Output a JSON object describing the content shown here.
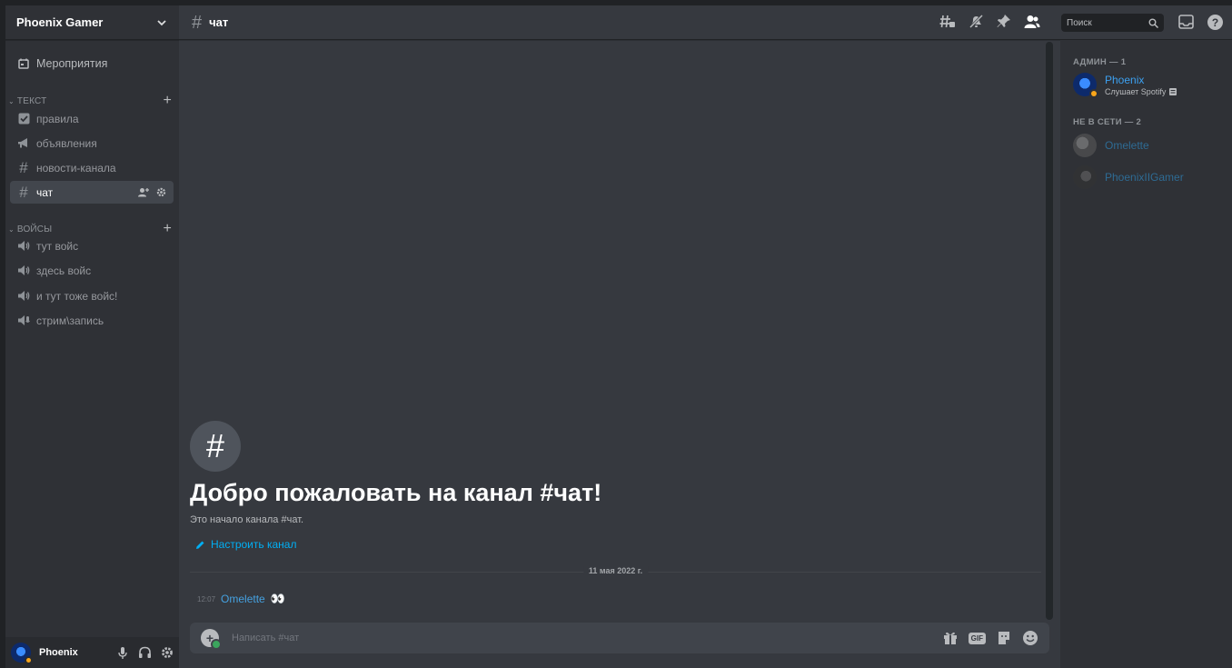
{
  "server": {
    "name": "Phoenix Gamer"
  },
  "sidebar": {
    "events_label": "Мероприятия",
    "categories": [
      {
        "name": "ТЕКСТ"
      },
      {
        "name": "ВОЙСЫ"
      }
    ],
    "text_channels": [
      {
        "label": "правила",
        "icon": "rules-icon"
      },
      {
        "label": "объявления",
        "icon": "megaphone-icon"
      },
      {
        "label": "новости-канала",
        "icon": "hash-icon"
      },
      {
        "label": "чат",
        "icon": "hash-icon",
        "active": true
      }
    ],
    "voice_channels": [
      {
        "label": "тут войс",
        "icon": "speaker-icon"
      },
      {
        "label": "здесь войс",
        "icon": "speaker-icon"
      },
      {
        "label": "и тут тоже войс!",
        "icon": "speaker-icon"
      },
      {
        "label": "стрим\\запись",
        "icon": "stage-speaker-icon"
      }
    ]
  },
  "user_panel": {
    "username": "Phoenix",
    "status_color": "#faa61a"
  },
  "channel": {
    "name": "чат",
    "welcome_title": "Добро пожаловать на канал #чат!",
    "welcome_sub": "Это начало канала #чат.",
    "edit_link": "Настроить канал",
    "date_divider": "11 мая 2022 г."
  },
  "messages": [
    {
      "time": "12:07",
      "author": "Omelette",
      "content": "👀"
    }
  ],
  "composer": {
    "placeholder": "Написать #чат"
  },
  "header": {
    "search_placeholder": "Поиск"
  },
  "members": {
    "groups": [
      {
        "title": "АДМИН — 1"
      },
      {
        "title": "НЕ В СЕТИ — 2"
      }
    ],
    "list": [
      {
        "name": "Phoenix",
        "activity": "Слушает Spotify",
        "status": "online"
      },
      {
        "name": "Omelette",
        "status": "offline"
      },
      {
        "name": "PhoenixIIGamer",
        "status": "offline"
      }
    ]
  },
  "colors": {
    "accent": "#00aff4",
    "online_name": "#3ca0f0",
    "idle": "#faa61a",
    "background": "#36393f"
  }
}
